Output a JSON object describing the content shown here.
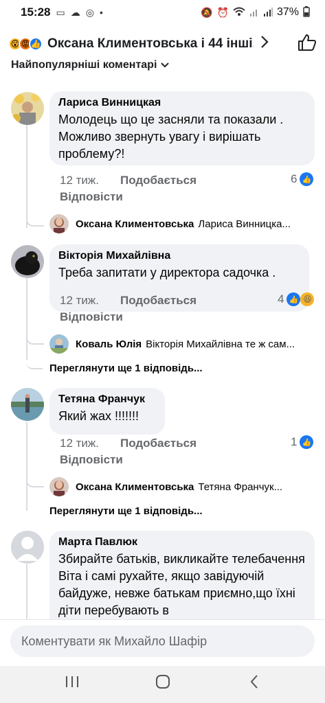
{
  "status": {
    "time": "15:28",
    "battery": "37%",
    "icons_left": [
      "calendar-icon",
      "cloud-icon",
      "instagram-icon",
      "dot-icon"
    ],
    "icons_right": [
      "mute-icon",
      "alarm-icon",
      "wifi-icon",
      "signal-icon",
      "signal-icon",
      "battery-icon"
    ]
  },
  "header": {
    "title": "Оксана Климентовська і 44 інші...",
    "reactions": [
      "wow",
      "angry",
      "like"
    ]
  },
  "sort": {
    "label": "Найпопулярніші коментарі"
  },
  "comments": [
    {
      "name": "Лариса Винницкая",
      "text": "Молодець що це засняли та показали  . Можливо звернуть увагу і вирішать проблему?!",
      "time": "12 тиж.",
      "like": "Подобається",
      "reply": "Відповісти",
      "count": "6",
      "reply_preview": {
        "name": "Оксана Климентовська",
        "text": "Лариса Винницка..."
      }
    },
    {
      "name": "Вікторія Михайлівна",
      "text": "Треба запитати у директора садочка .",
      "time": "12 тиж.",
      "like": "Подобається",
      "reply": "Відповісти",
      "count": "4",
      "reply_preview": {
        "name": "Коваль Юлія",
        "text": "Вікторія Михайлівна те ж сам..."
      },
      "more": "Переглянути ще 1 відповідь..."
    },
    {
      "name": "Тетяна Франчук",
      "text": "Який жах !!!!!!!",
      "time": "12 тиж.",
      "like": "Подобається",
      "reply": "Відповісти",
      "count": "1",
      "reply_preview": {
        "name": "Оксана Климентовська",
        "text": "Тетяна Франчук..."
      },
      "more": "Переглянути ще 1 відповідь..."
    },
    {
      "name": "Марта Павлюк",
      "text": "Збирайте батьків, викликайте телебачення Віта і самі рухайте, якщо завідуючій байдуже, невже батькам приємно,що їхні діти перебувають в"
    }
  ],
  "composer": {
    "placeholder": "Коментувати як Михайло Шафір"
  },
  "nav": {
    "buttons": [
      "recent-apps",
      "home",
      "back"
    ]
  }
}
